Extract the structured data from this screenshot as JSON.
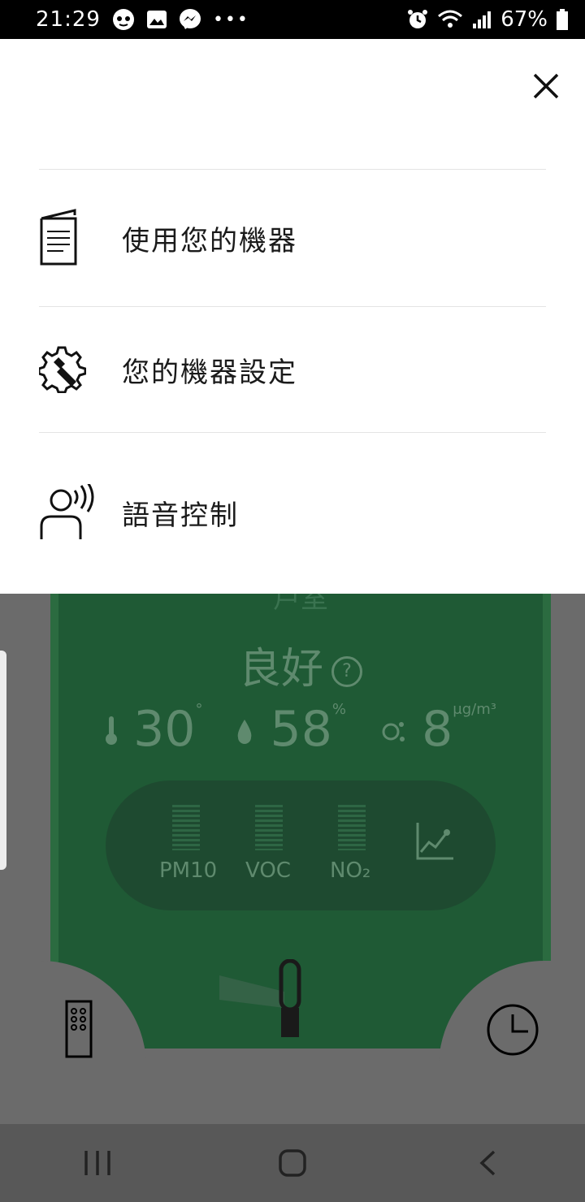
{
  "status_bar": {
    "time": "21:29",
    "battery": "67%",
    "notif_icons": [
      "bixby-icon",
      "image-icon",
      "messenger-icon",
      "more-dots-icon"
    ],
    "system_icons": [
      "alarm-icon",
      "wifi-icon",
      "signal-icon",
      "battery-icon"
    ]
  },
  "menu": {
    "close_icon": "close-icon",
    "items": [
      {
        "label": "使用您的機器",
        "icon": "manual-icon"
      },
      {
        "label": "您的機器設定",
        "icon": "settings-wrench-icon"
      },
      {
        "label": "語音控制",
        "icon": "voice-control-icon"
      }
    ]
  },
  "background_app": {
    "partial_heading": "戶室",
    "air_quality": "良好",
    "temperature": "30",
    "temp_unit": "°",
    "humidity": "58",
    "humidity_unit": "%",
    "particles": "8",
    "particles_unit": "μg/m³",
    "pollutants": [
      "PM10",
      "VOC",
      "NO₂"
    ]
  },
  "nav_bar": {
    "buttons": [
      "recent-apps-icon",
      "home-icon",
      "back-icon"
    ]
  },
  "colors": {
    "panel_green": "#1f5a35",
    "dim_overlay": "#6b6b6b",
    "sheet_bg": "#ffffff"
  }
}
